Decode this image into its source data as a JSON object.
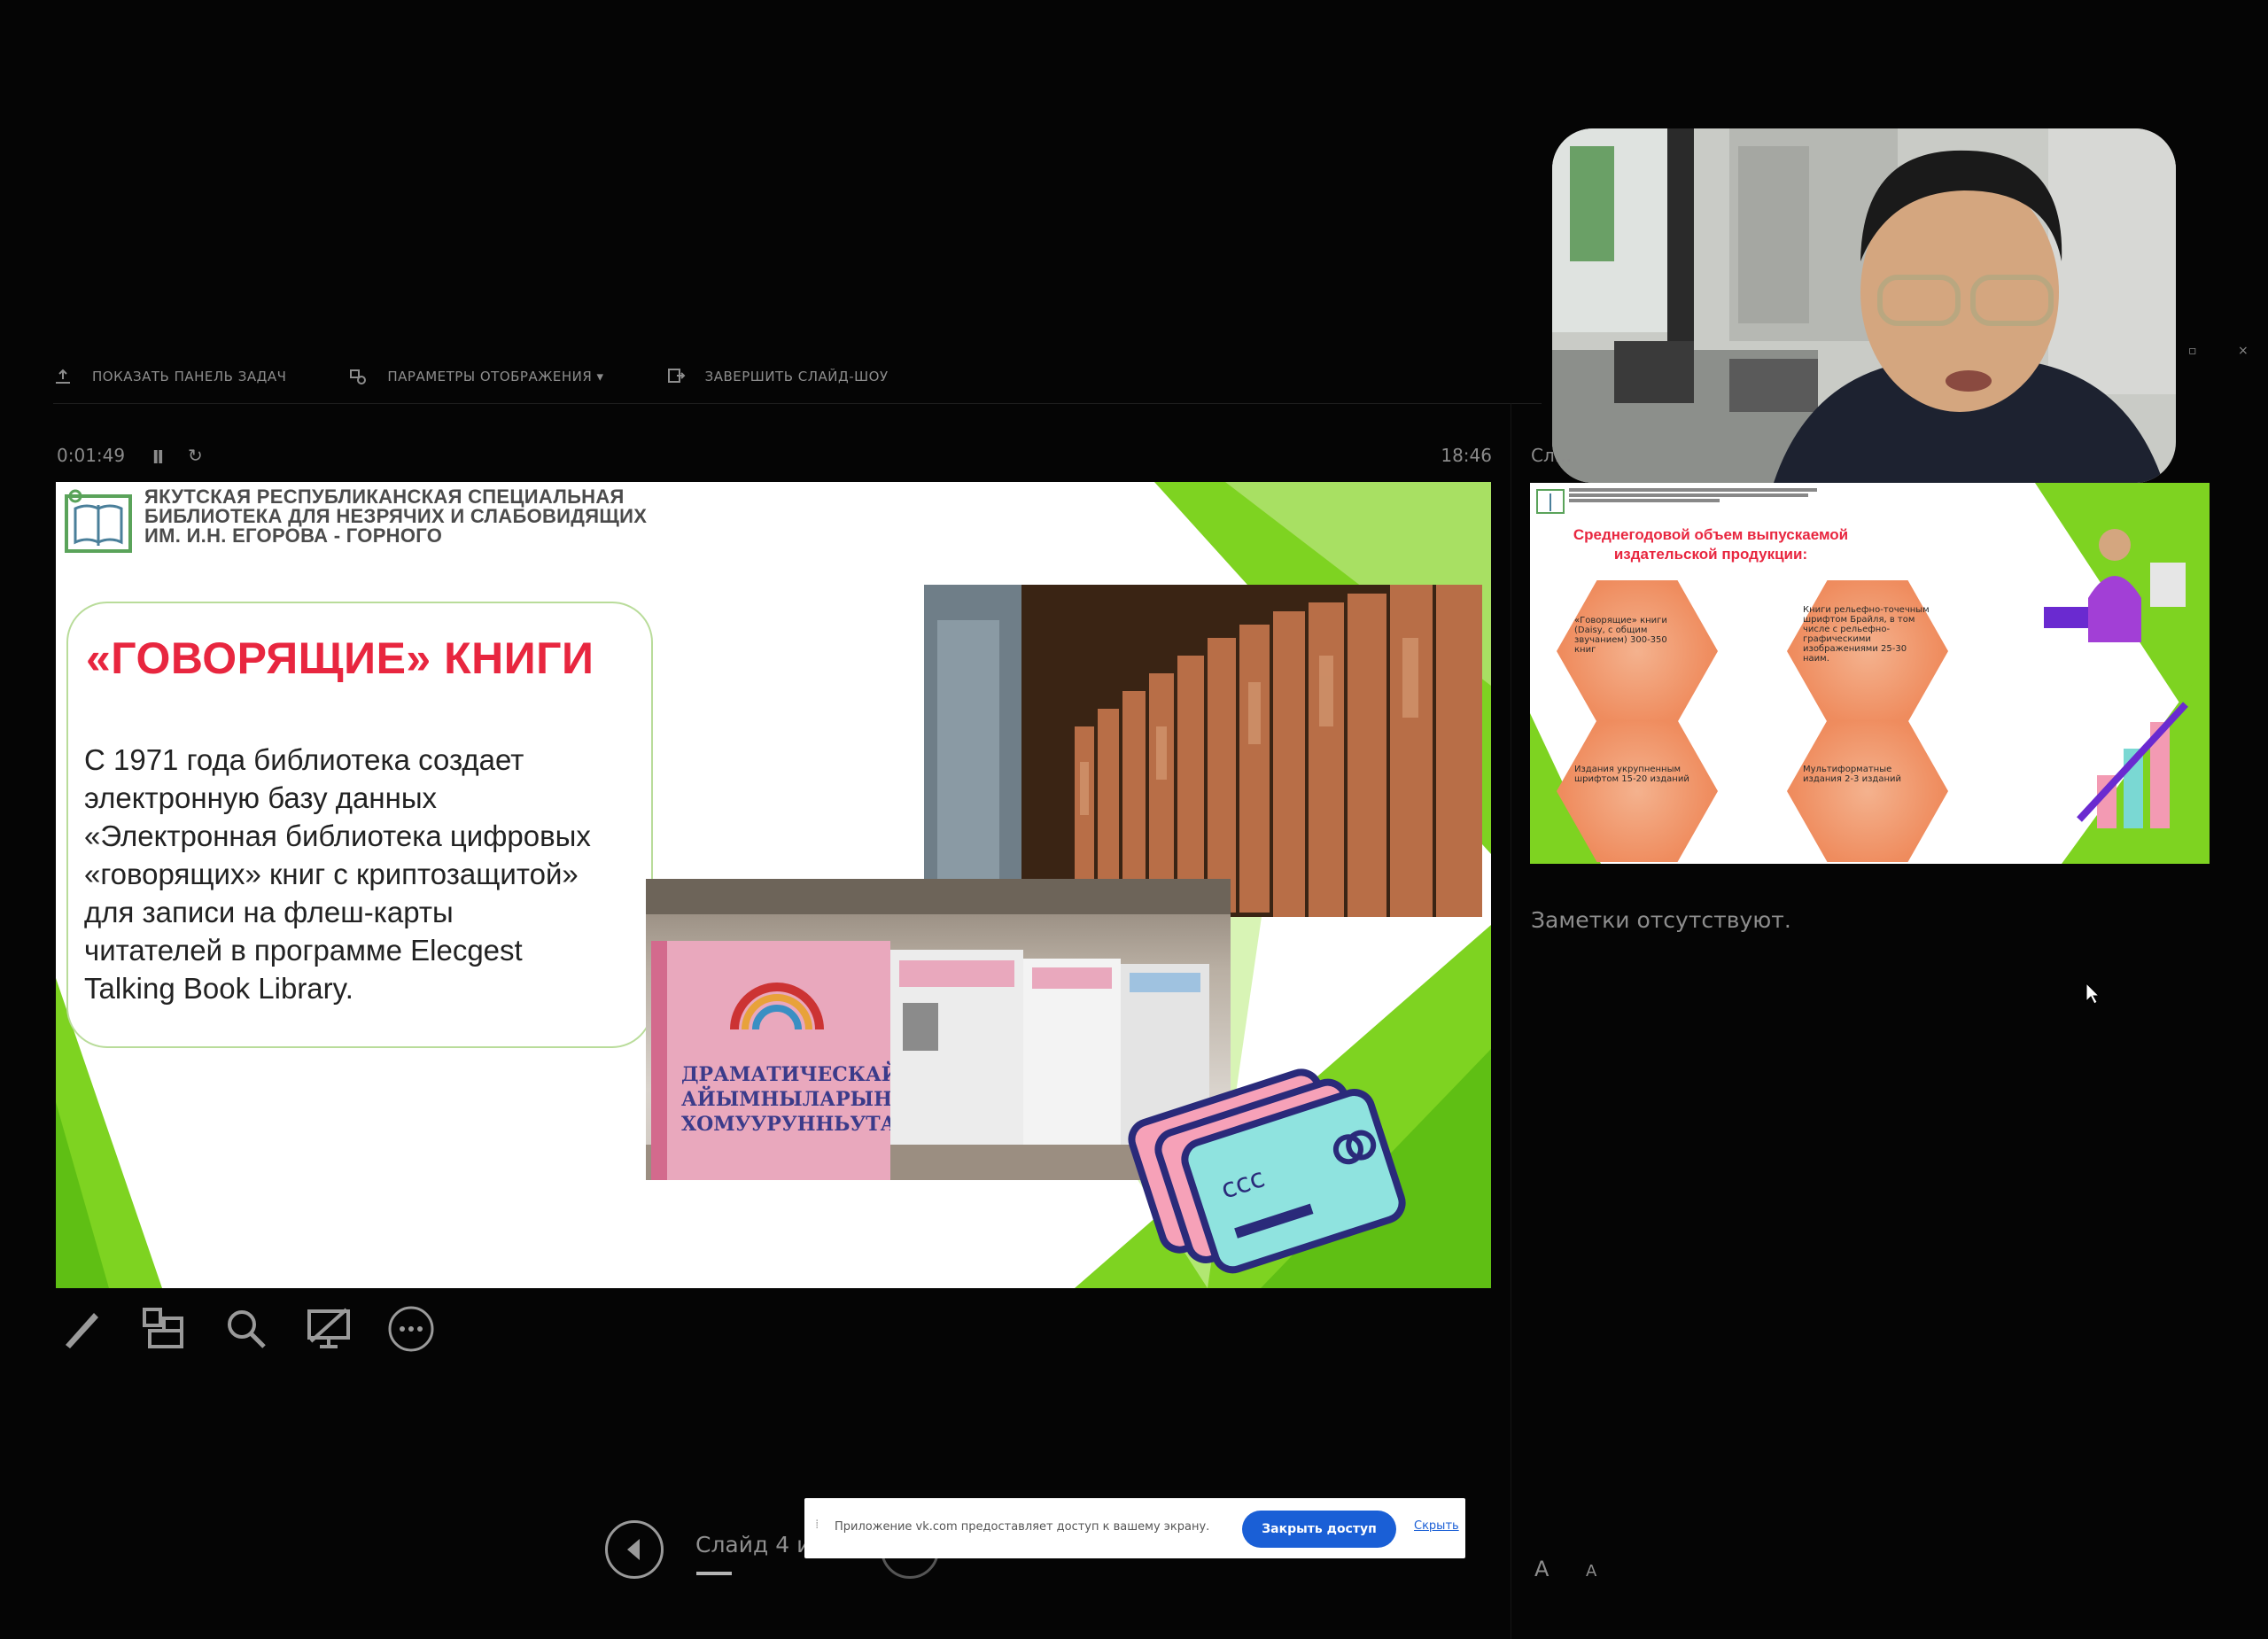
{
  "toolbar": {
    "show_taskbar": "ПОКАЗАТЬ ПАНЕЛЬ ЗАДАЧ",
    "display_settings": "ПАРАМЕТРЫ ОТОБРАЖЕНИЯ ▾",
    "end_slideshow": "ЗАВЕРШИТЬ СЛАЙД-ШОУ"
  },
  "presenter": {
    "elapsed": "0:01:49",
    "pause_glyph": "II",
    "restart_glyph": "↻",
    "clock": "18:46"
  },
  "slide": {
    "org_line1": "ЯКУТСКАЯ РЕСПУБЛИКАНСКАЯ СПЕЦИАЛЬНАЯ",
    "org_line2": "БИБЛИОТЕКА ДЛЯ НЕЗРЯЧИХ И СЛАБОВИДЯЩИХ",
    "org_line3": "ИМ. И.Н. ЕГОРОВА - ГОРНОГО",
    "title": "«ГОВОРЯЩИЕ» КНИГИ",
    "body_lines": [
      "С 1971 года библиотека создает",
      "электронную базу данных",
      "«Электронная библиотека цифровых",
      "«говорящих» книг с криптозащитой»",
      "для записи на флеш-карты",
      "читателей в программе Elecgest",
      "Talking Book Library."
    ],
    "book_cover_lines": [
      "ДРАМАТИЧЕСКАЙ",
      "АЙЫМНЫЛАРЫН",
      "ХОМУУРУННЬУТА"
    ],
    "card_text": "ccc"
  },
  "next_slide": {
    "label": "Сл...",
    "title_line1": "Среднегодовой объем выпускаемой",
    "title_line2": "издательской продукции:",
    "hex1": "«Говорящие» книги (Daisy, с общим звучанием) 300-350 книг",
    "hex2": "Книги рельефно-точечным шрифтом Брайля, в том числе с рельефно-графическими изображениями 25-30 наим.",
    "hex3": "Издания укрупненным шрифтом 15-20 изданий",
    "hex4": "Мультиформатные издания 2-3 изданий"
  },
  "notes": {
    "text": "Заметки отсутствуют."
  },
  "navigation": {
    "counter": "Слайд 4 и"
  },
  "share_bar": {
    "message": "Приложение vk.com предоставляет доступ к вашему экрану.",
    "close_button": "Закрыть доступ",
    "hide_link": "Скрыть"
  },
  "font_controls": {
    "increase": "A",
    "decrease": "A"
  },
  "colors": {
    "accent_green": "#7ed321",
    "title_red": "#e8263f",
    "button_blue": "#1a5fd6"
  }
}
